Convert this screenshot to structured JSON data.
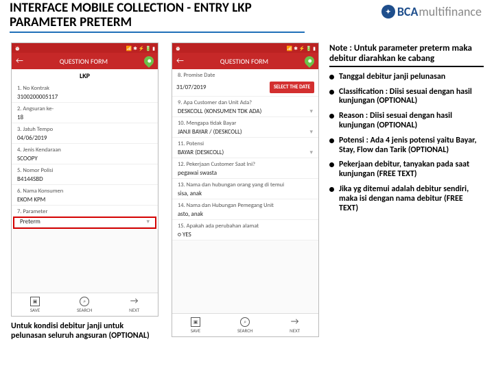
{
  "title": "INTERFACE MOBILE COLLECTION - ENTRY LKP PARAMETER PRETERM",
  "brand": {
    "bca": "BCA",
    "multi": "multifinance"
  },
  "status": {
    "left": "⏰",
    "right": "📶 ✱ ⚡ 🔋 ▮"
  },
  "appbar": {
    "back": "←",
    "title": "QUESTION FORM"
  },
  "lkp_label": "LKP",
  "left_phone": {
    "fields": [
      {
        "label": "1. No Kontrak",
        "value": "3100200005117"
      },
      {
        "label": "2. Angsuran ke-",
        "value": "18"
      },
      {
        "label": "3. Jatuh Tempo",
        "value": "04/06/2019"
      },
      {
        "label": "4. Jenis Kendaraan",
        "value": "SCOOPY"
      },
      {
        "label": "5. Nomor Polisi",
        "value": "B4144SBD"
      },
      {
        "label": "6. Nama Konsumen",
        "value": "EKOM KPM"
      },
      {
        "label": "7. Parameter",
        "value": "Preterm"
      }
    ]
  },
  "right_phone": {
    "promise_label": "8. Promise Date",
    "promise_value": "31/07/2019",
    "select_btn": "SELECT THE DATE",
    "fields": [
      {
        "label": "9. Apa Customer dan Unit Ada?",
        "value": "DESKCOLL (KONSUMEN TDK ADA)",
        "dd": true
      },
      {
        "label": "10. Mengapa tidak Bayar",
        "value": "JANJI BAYAR / (DESKCOLL)",
        "dd": true
      },
      {
        "label": "11. Potensi",
        "value": "BAYAR (DESKCOLL)",
        "dd": true
      },
      {
        "label": "12. Pekerjaan Customer Saat Ini?",
        "value": "pegawai swasta"
      },
      {
        "label": "13. Nama dan hubungan orang yang di temui",
        "value": "sisa, anak"
      },
      {
        "label": "14. Nama dan Hubungan Pemegang Unit",
        "value": "asto, anak"
      },
      {
        "label": "15. Apakah ada perubahan alamat",
        "value": "○ YES"
      }
    ]
  },
  "nav": {
    "save": "SAVE",
    "search": "SEARCH",
    "next": "NEXT",
    "next_icon": "→"
  },
  "notes": {
    "head": "Note : Untuk parameter preterm maka debitur diarahkan ke cabang",
    "items": [
      "Tanggal debitur janji pelunasan",
      "Classification : Diisi sesuai dengan hasil kunjungan (OPTIONAL)",
      "Reason : Diisi sesuai dengan hasil kunjungan (OPTIONAL)",
      "Potensi : Ada 4 jenis potensi yaitu Bayar, Stay, Flow dan Tarik (OPTIONAL)",
      "Pekerjaan debitur, tanyakan pada saat kunjungan (FREE TEXT)",
      "Jika yg ditemui adalah debitur sendiri, maka isi dengan nama debitur (FREE TEXT)"
    ]
  },
  "footnote": "Untuk kondisi debitur janji untuk pelunasan seluruh angsuran (OPTIONAL)"
}
